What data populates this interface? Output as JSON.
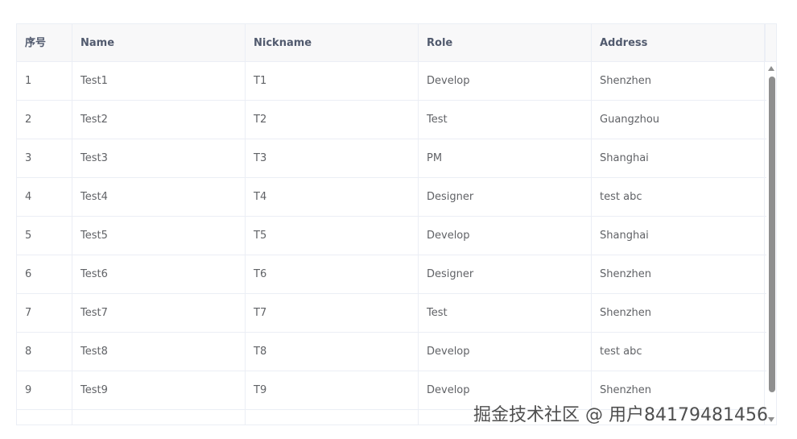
{
  "table": {
    "columns": [
      "序号",
      "Name",
      "Nickname",
      "Role",
      "Address"
    ],
    "rows": [
      [
        "1",
        "Test1",
        "T1",
        "Develop",
        "Shenzhen"
      ],
      [
        "2",
        "Test2",
        "T2",
        "Test",
        "Guangzhou"
      ],
      [
        "3",
        "Test3",
        "T3",
        "PM",
        "Shanghai"
      ],
      [
        "4",
        "Test4",
        "T4",
        "Designer",
        "test abc"
      ],
      [
        "5",
        "Test5",
        "T5",
        "Develop",
        "Shanghai"
      ],
      [
        "6",
        "Test6",
        "T6",
        "Designer",
        "Shenzhen"
      ],
      [
        "7",
        "Test7",
        "T7",
        "Test",
        "Shenzhen"
      ],
      [
        "8",
        "Test8",
        "T8",
        "Develop",
        "test abc"
      ],
      [
        "9",
        "Test9",
        "T9",
        "Develop",
        "Shenzhen"
      ],
      [
        "",
        "",
        "",
        "",
        ""
      ]
    ]
  },
  "watermark": "掘金技术社区 @ 用户84179481456",
  "colors": {
    "header_bg": "#f8f8f9",
    "border": "#ebeef5",
    "text": "#606266",
    "header_text": "#515a6e",
    "scrollbar": "#8f8f8f"
  }
}
